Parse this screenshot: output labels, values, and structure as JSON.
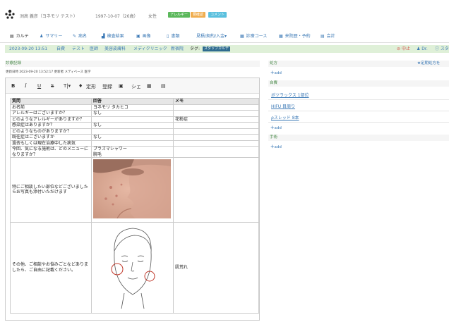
{
  "patient": {
    "name": "洲高 義彦（ヨネモリ テスト）",
    "birth": "1997-10-07（26歳）",
    "gender": "女性",
    "badges": [
      {
        "label": "アレルギー",
        "color": "#5cb85c"
      },
      {
        "label": "要確認",
        "color": "#f0ad4e"
      },
      {
        "label": "コメント",
        "color": "#5bc0de"
      }
    ]
  },
  "tabs": [
    {
      "label": "カルテ",
      "icon": "document-icon"
    },
    {
      "label": "サマリー",
      "icon": "person-icon"
    },
    {
      "label": "病名",
      "icon": "edit-icon"
    },
    {
      "label": "検査結果",
      "icon": "chart-icon"
    },
    {
      "label": "画像",
      "icon": "image-icon"
    },
    {
      "label": "書類",
      "icon": "file-icon"
    },
    {
      "label": "見積/契約/入金▾",
      "icon": ""
    },
    {
      "label": "診療コース",
      "icon": "grid-icon"
    },
    {
      "label": "来院歴・予約",
      "icon": "calendar-icon"
    },
    {
      "label": "会計",
      "icon": "register-icon"
    }
  ],
  "visit": {
    "datetime": "2023-09-20 13:51",
    "items": [
      "自費",
      "テスト",
      "医師",
      "美容皮膚科",
      "メディクリニック",
      "新宿院"
    ],
    "tag_label": "タグ:",
    "tag_badge": "スタッフカルテ",
    "stop": "中止",
    "doctor": "Dr.",
    "staff": "スタ"
  },
  "record": {
    "title": "診療記録",
    "meta": "更新日時 2023-09-20 13:52:17 更新者 メディベース 医学",
    "toolbar": [
      "B",
      "I",
      "U",
      "S",
      "T|▾",
      "♦",
      "定形",
      "登録",
      "▣",
      "シェ",
      "▦",
      "▤"
    ],
    "headers": [
      "質問",
      "回答",
      "メモ"
    ],
    "rows": [
      {
        "q": "お名前",
        "a": "ヨネモリ タカヒコ",
        "m": ""
      },
      {
        "q": "アレルギーはございますか？",
        "a": "なし",
        "m": ""
      },
      {
        "q": "どのようなアレルギーがありますか？",
        "a": "",
        "m": "花粉症"
      },
      {
        "q": "感染症はありますか？",
        "a": "なし",
        "m": ""
      },
      {
        "q": "どのようなものがありますか？",
        "a": "",
        "m": ""
      },
      {
        "q": "既往症はございますか",
        "a": "なし",
        "m": ""
      },
      {
        "q": "過去もしくは現在治療中した病気",
        "a": "",
        "m": ""
      },
      {
        "q": "今回、気になる施術は、どのメニューになりますか？",
        "a": "プラズマシャワー\n腕毛",
        "m": ""
      },
      {
        "q": "特にご相談したい部位などございましたらお写真も添付いただけます",
        "a": "",
        "m": ""
      },
      {
        "q": "その他、ご相談やお悩みごとなどありましたら、ご自由に記載ください。",
        "a": "",
        "m": "肌荒れ"
      }
    ]
  },
  "right": {
    "prescription": {
      "title": "処方",
      "link": "★定期処方を",
      "add": "add"
    },
    "procedures": {
      "title": "自費",
      "items": [
        "ボツラックス 1部位",
        "HIFU 目周り",
        "ρスレッド 8本"
      ],
      "add": "add"
    },
    "surgery": {
      "title": "手術",
      "add": "add"
    }
  },
  "colors": {
    "accent": "#3a78b5",
    "green_bar": "#dff0d8"
  }
}
